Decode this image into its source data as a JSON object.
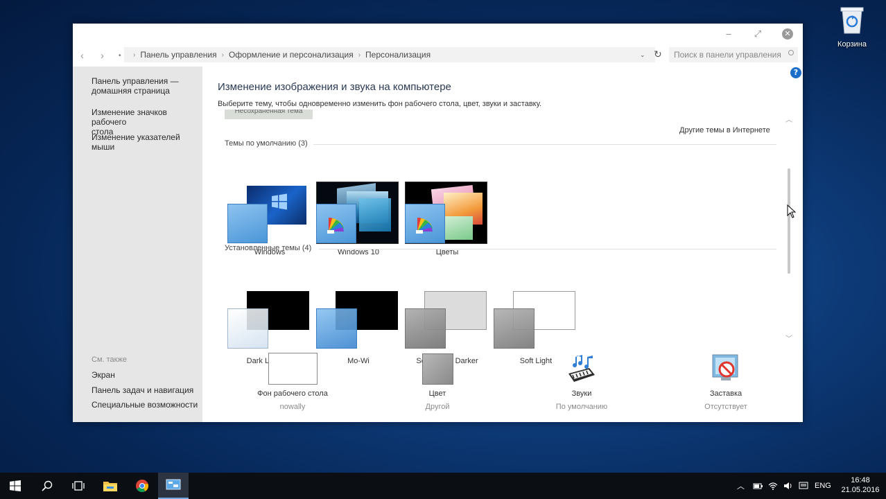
{
  "desktop": {
    "recycle_bin_label": "Корзина"
  },
  "window": {
    "controls": {
      "minimize": "‒",
      "maximize": "⤢",
      "close": "✕"
    },
    "address": {
      "breadcrumbs": [
        "Панель управления",
        "Оформление и персонализация",
        "Персонализация"
      ],
      "search_placeholder": "Поиск в панели управления"
    },
    "sidebar": {
      "links": [
        "Панель управления —\nдомашняя страница",
        "Изменение значков рабочего\nстола",
        "Изменение указателей мыши"
      ],
      "see_also_title": "См. также",
      "see_also": [
        "Экран",
        "Панель задач и навигация",
        "Специальные возможности"
      ]
    },
    "help_label": "?",
    "content": {
      "heading": "Изменение изображения и звука на компьютере",
      "subheading": "Выберите тему, чтобы одновременно изменить фон рабочего стола, цвет, звуки и заставку.",
      "saved_tab": "Несохраненная тема",
      "online_link": "Другие темы в Интернете",
      "default_group": "Темы по умолчанию (3)",
      "installed_group": "Установленные темы (4)",
      "default_themes": [
        "Windows",
        "Windows 10",
        "Цветы"
      ],
      "installed_themes": [
        "Dark Leopard",
        "Mo-Wi",
        "Soft Light - Darker",
        "Soft Light"
      ],
      "bottom": [
        {
          "title": "Фон рабочего стола",
          "value": "nowally"
        },
        {
          "title": "Цвет",
          "value": "Другой"
        },
        {
          "title": "Звуки",
          "value": "По умолчанию"
        },
        {
          "title": "Заставка",
          "value": "Отсутствует"
        }
      ]
    }
  },
  "taskbar": {
    "apps": [
      "start-button",
      "search-button",
      "task-view-button",
      "file-explorer",
      "chrome",
      "control-panel"
    ],
    "language": "ENG",
    "time": "16:48",
    "date": "21.05.2016"
  },
  "colors": {
    "accent": "#1c6fc9",
    "sidebar": "#e6e6e6",
    "taskbar": "#0b0f14"
  }
}
